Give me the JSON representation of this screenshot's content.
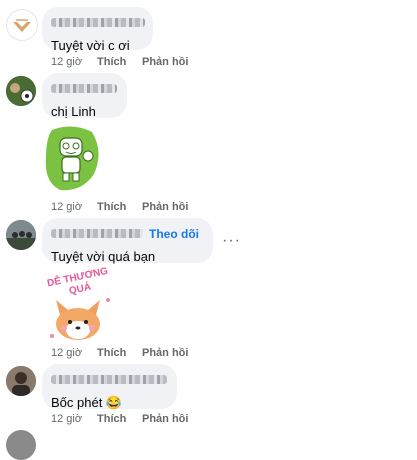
{
  "comments": [
    {
      "text": "Tuyệt vời c ơi",
      "time": "12 giờ",
      "like": "Thích",
      "reply": "Phản hồi"
    },
    {
      "text": "chị Linh",
      "time": "12 giờ",
      "like": "Thích",
      "reply": "Phản hồi"
    },
    {
      "text": "Tuyệt vời quá bạn",
      "follow": "Theo dõi",
      "more": "···",
      "time": "12 giờ",
      "like": "Thích",
      "reply": "Phản hồi"
    },
    {
      "text": "Bốc phét 😂",
      "time": "12 giờ",
      "like": "Thích",
      "reply": "Phản hồi"
    }
  ],
  "stickers": {
    "second": "DỄ THƯƠNG QUÁ"
  },
  "colors": {
    "bubble": "#f0f2f5",
    "link": "#1877f2",
    "meta": "#65676b"
  }
}
